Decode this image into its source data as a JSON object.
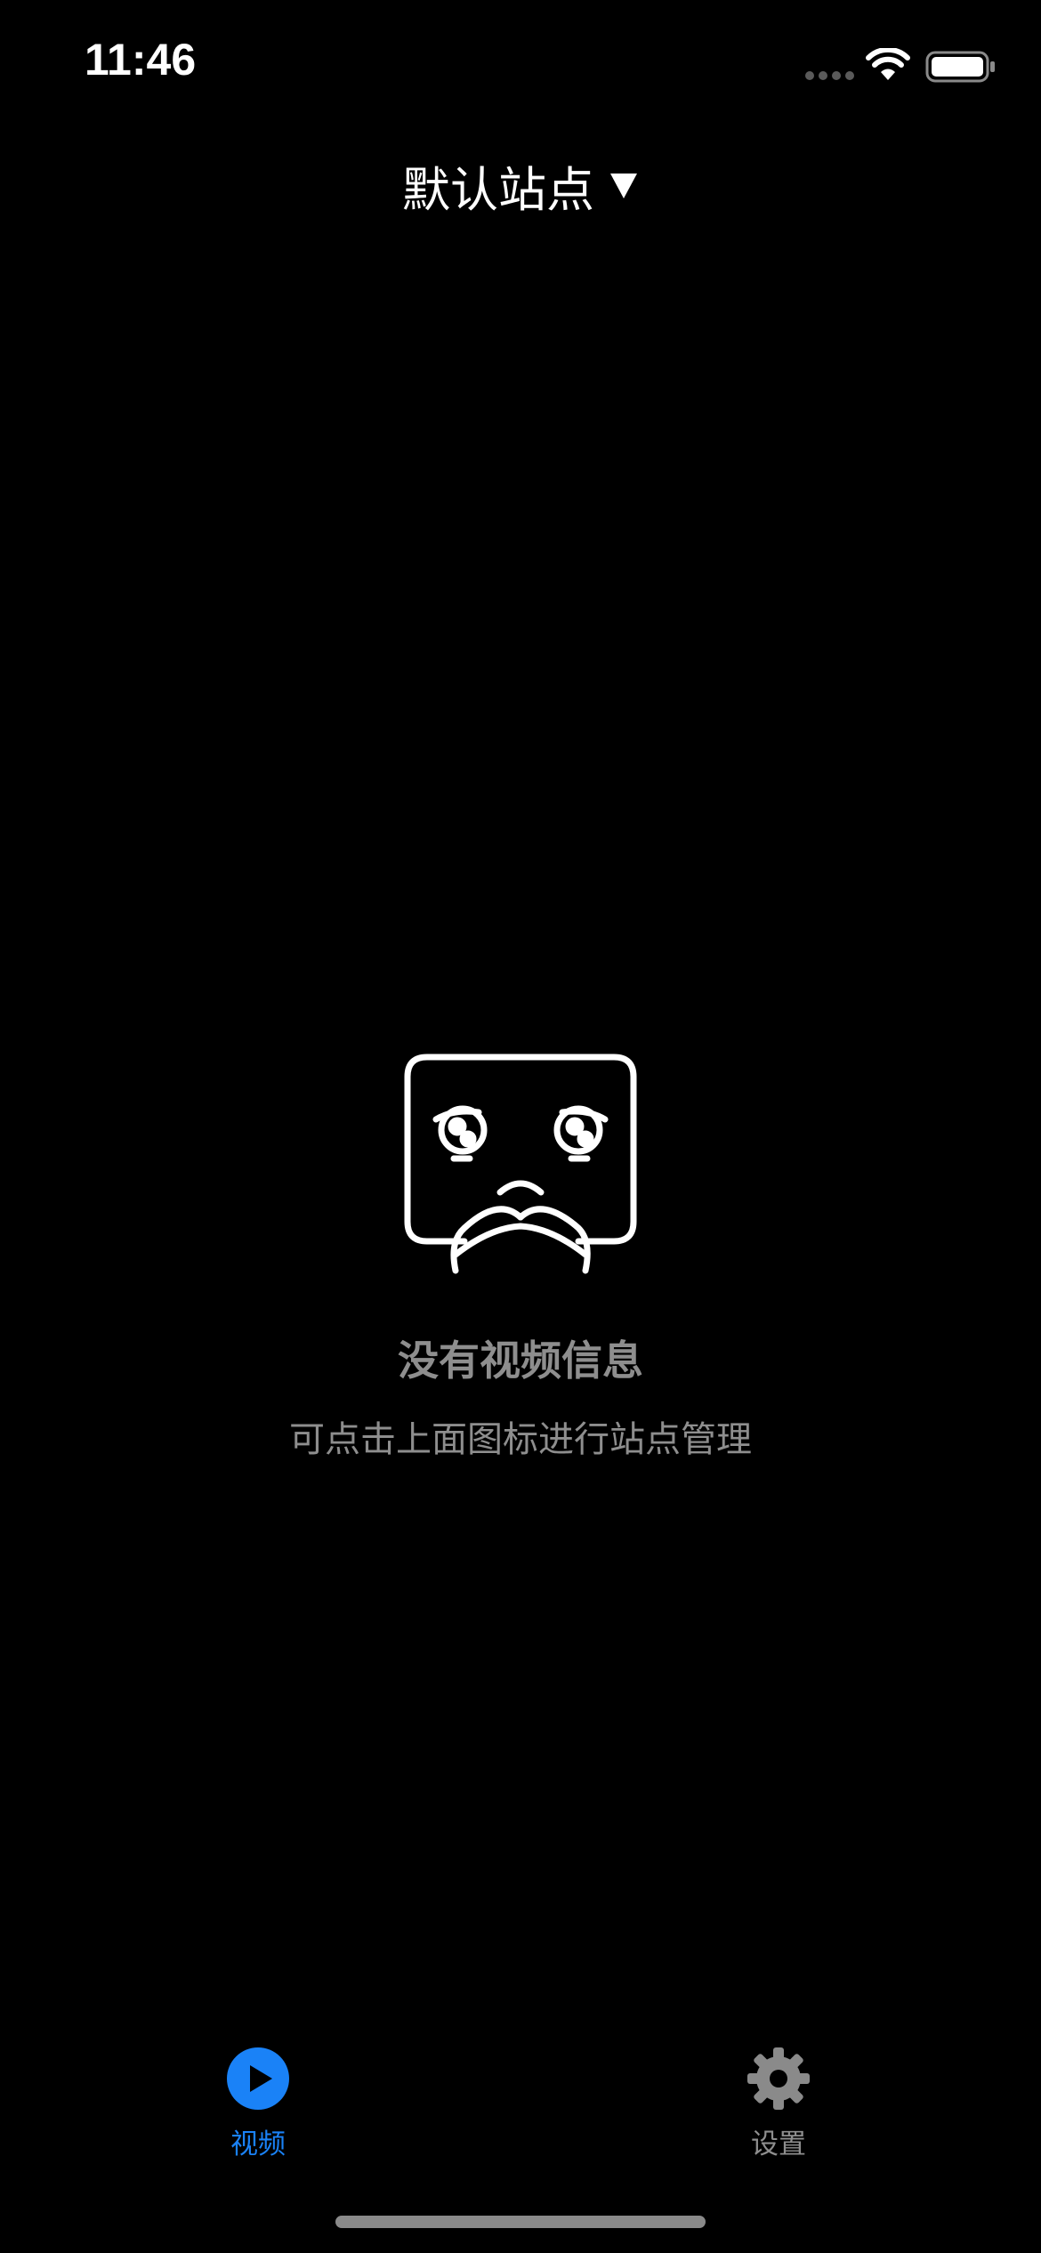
{
  "status_bar": {
    "time": "11:46"
  },
  "header": {
    "site_title": "默认站点",
    "dropdown_icon": "caret-down-icon"
  },
  "empty_state": {
    "icon": "sad-tv-icon",
    "title": "没有视频信息",
    "hint": "可点击上面图标进行站点管理"
  },
  "tab_bar": {
    "tabs": [
      {
        "label": "视频",
        "icon": "play-circle-icon",
        "selected": true
      },
      {
        "label": "设置",
        "icon": "gear-icon",
        "selected": false
      }
    ]
  },
  "colors": {
    "background": "#000000",
    "accent": "#1a82f7",
    "muted_text": "#8e8e8e",
    "primary_text": "#ffffff"
  }
}
